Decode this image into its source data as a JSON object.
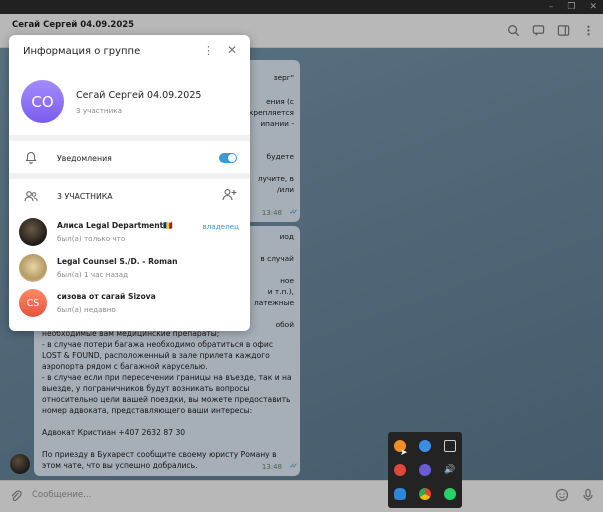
{
  "window": {
    "chat_title": "Сегай Сергей 04.09.2025"
  },
  "chat": {
    "msg1_frags": [
      "зерг\"",
      "ения (с",
      "крепляется",
      "ипании -",
      "будете",
      "лучите, в",
      "/или"
    ],
    "msg1_time": "13:48",
    "msg2_frags": [
      "иод",
      "в случай",
      "ное",
      "и т.п.),",
      "латежные",
      "обой"
    ],
    "msg2_lines": [
      "необходимые вам медицинские препараты;",
      "- в случае потери багажа необходимо обратиться в офис LOST & FOUND, расположенный в зале прилета каждого аэропорта рядом с багажной каруселью.",
      "- в случае если при пересечении границы на въезде, так и на выезде, у пограничников будут возникать вопросы относительно цели вашей поездки, вы можете предоставить номер адвоката, представляющего ваши интересы:",
      "",
      "Адвокат Кристиан +407 2632 87 30",
      "",
      "По приезду в Бухарест сообщите своему юристу Роману в этом чате, что вы успешно добрались."
    ],
    "msg2_time": "13:48",
    "composer_placeholder": "Сообщение..."
  },
  "modal": {
    "title": "Информация о группе",
    "group_avatar_initials": "СО",
    "group_name": "Сегай Сергей 04.09.2025",
    "group_count": "3 участника",
    "notifications_label": "Уведомления",
    "notifications_on": true,
    "members_header": "3 УЧАСТНИКА",
    "members": [
      {
        "name": "Алиса Legal Department🇷🇴",
        "status": "был(а) только что",
        "role": "владелец"
      },
      {
        "name": "Legal Counsel S./D. - Roman",
        "status": "был(а) 1 час назад",
        "role": ""
      },
      {
        "name": "сизова от сагай Sizova",
        "status": "был(а) недавно",
        "role": "",
        "initials": "CS"
      }
    ]
  },
  "colors": {
    "accent": "#3e96d3",
    "group_avatar": "#8b6cf5",
    "member_cs_avatar": "#f06b4f",
    "bubble": "#e7f3ff"
  }
}
